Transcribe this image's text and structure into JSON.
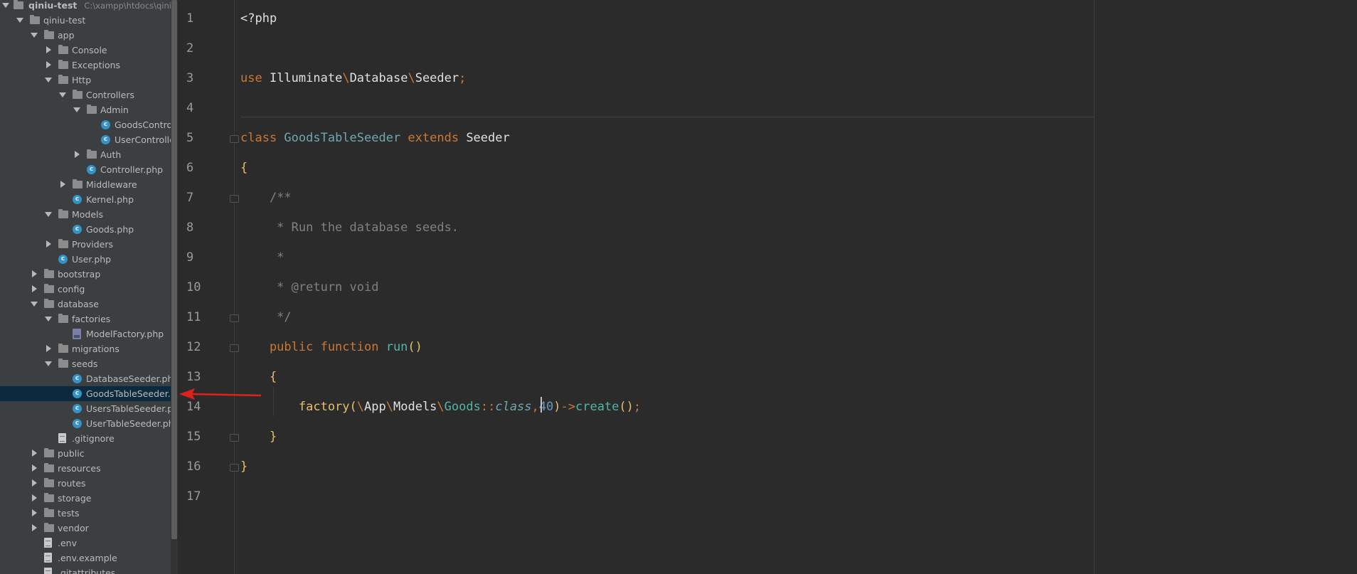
{
  "project": {
    "root_name": "qiniu-test",
    "root_path": "C:\\xampp\\htdocs\\qiniu-t"
  },
  "tree": [
    {
      "label": "qiniu-test",
      "kind": "folder",
      "depth": 1,
      "open": true
    },
    {
      "label": "app",
      "kind": "folder",
      "depth": 2,
      "open": true
    },
    {
      "label": "Console",
      "kind": "folder",
      "depth": 3,
      "open": false
    },
    {
      "label": "Exceptions",
      "kind": "folder",
      "depth": 3,
      "open": false
    },
    {
      "label": "Http",
      "kind": "folder",
      "depth": 3,
      "open": true
    },
    {
      "label": "Controllers",
      "kind": "folder",
      "depth": 4,
      "open": true
    },
    {
      "label": "Admin",
      "kind": "folder",
      "depth": 5,
      "open": true
    },
    {
      "label": "GoodsControlle",
      "kind": "class",
      "depth": 6
    },
    {
      "label": "UserController.",
      "kind": "class",
      "depth": 6
    },
    {
      "label": "Auth",
      "kind": "folder",
      "depth": 5,
      "open": false
    },
    {
      "label": "Controller.php",
      "kind": "class",
      "depth": 5
    },
    {
      "label": "Middleware",
      "kind": "folder",
      "depth": 4,
      "open": false
    },
    {
      "label": "Kernel.php",
      "kind": "class",
      "depth": 4
    },
    {
      "label": "Models",
      "kind": "folder",
      "depth": 3,
      "open": true
    },
    {
      "label": "Goods.php",
      "kind": "class",
      "depth": 4
    },
    {
      "label": "Providers",
      "kind": "folder",
      "depth": 3,
      "open": false
    },
    {
      "label": "User.php",
      "kind": "class",
      "depth": 3
    },
    {
      "label": "bootstrap",
      "kind": "folder",
      "depth": 2,
      "open": false
    },
    {
      "label": "config",
      "kind": "folder",
      "depth": 2,
      "open": false
    },
    {
      "label": "database",
      "kind": "folder",
      "depth": 2,
      "open": true
    },
    {
      "label": "factories",
      "kind": "folder",
      "depth": 3,
      "open": true
    },
    {
      "label": "ModelFactory.php",
      "kind": "php",
      "depth": 4
    },
    {
      "label": "migrations",
      "kind": "folder",
      "depth": 3,
      "open": false
    },
    {
      "label": "seeds",
      "kind": "folder",
      "depth": 3,
      "open": true
    },
    {
      "label": "DatabaseSeeder.php",
      "kind": "class",
      "depth": 4
    },
    {
      "label": "GoodsTableSeeder.ph",
      "kind": "class",
      "depth": 4,
      "selected": true
    },
    {
      "label": "UsersTableSeeder.php",
      "kind": "class",
      "depth": 4
    },
    {
      "label": "UserTableSeeder.php",
      "kind": "class",
      "depth": 4
    },
    {
      "label": ".gitignore",
      "kind": "file",
      "depth": 3
    },
    {
      "label": "public",
      "kind": "folder",
      "depth": 2,
      "open": false
    },
    {
      "label": "resources",
      "kind": "folder",
      "depth": 2,
      "open": false
    },
    {
      "label": "routes",
      "kind": "folder",
      "depth": 2,
      "open": false
    },
    {
      "label": "storage",
      "kind": "folder",
      "depth": 2,
      "open": false
    },
    {
      "label": "tests",
      "kind": "folder",
      "depth": 2,
      "open": false
    },
    {
      "label": "vendor",
      "kind": "folder",
      "depth": 2,
      "open": false
    },
    {
      "label": ".env",
      "kind": "file",
      "depth": 2
    },
    {
      "label": ".env.example",
      "kind": "file",
      "depth": 2
    },
    {
      "label": ".gitattributes",
      "kind": "file",
      "depth": 2
    }
  ],
  "editor": {
    "line_numbers": [
      "1",
      "2",
      "3",
      "4",
      "5",
      "6",
      "7",
      "8",
      "9",
      "10",
      "11",
      "12",
      "13",
      "14",
      "15",
      "16",
      "17"
    ],
    "lines": [
      [
        {
          "t": "<?php",
          "c": "plain"
        }
      ],
      [],
      [
        {
          "t": "use ",
          "c": "kw"
        },
        {
          "t": "Illuminate",
          "c": "plain"
        },
        {
          "t": "\\",
          "c": "kw"
        },
        {
          "t": "Database",
          "c": "plain"
        },
        {
          "t": "\\",
          "c": "kw"
        },
        {
          "t": "Seeder",
          "c": "plain"
        },
        {
          "t": ";",
          "c": "kw"
        }
      ],
      [],
      [
        {
          "t": "class ",
          "c": "kw"
        },
        {
          "t": "GoodsTableSeeder ",
          "c": "cls-name"
        },
        {
          "t": "extends ",
          "c": "kw"
        },
        {
          "t": "Seeder",
          "c": "plain"
        }
      ],
      [
        {
          "t": "{",
          "c": "brace"
        }
      ],
      [
        {
          "t": "    /**",
          "c": "cmt"
        }
      ],
      [
        {
          "t": "     * Run the database seeds.",
          "c": "cmt"
        }
      ],
      [
        {
          "t": "     *",
          "c": "cmt"
        }
      ],
      [
        {
          "t": "     * @return ",
          "c": "cmt"
        },
        {
          "t": "void",
          "c": "cmt"
        }
      ],
      [
        {
          "t": "     */",
          "c": "cmt"
        }
      ],
      [
        {
          "t": "    public function ",
          "c": "kw"
        },
        {
          "t": "run",
          "c": "fn"
        },
        {
          "t": "()",
          "c": "brace"
        }
      ],
      [
        {
          "t": "    {",
          "c": "brace"
        }
      ],
      [
        {
          "t": "        factory",
          "c": "brace"
        },
        {
          "t": "(",
          "c": "brace"
        },
        {
          "t": "\\",
          "c": "kw"
        },
        {
          "t": "App",
          "c": "plain"
        },
        {
          "t": "\\",
          "c": "kw"
        },
        {
          "t": "Models",
          "c": "plain"
        },
        {
          "t": "\\",
          "c": "kw"
        },
        {
          "t": "Goods",
          "c": "fn"
        },
        {
          "t": "::",
          "c": "kw"
        },
        {
          "t": "class",
          "c": "ital"
        },
        {
          "t": ",",
          "c": "kw"
        },
        {
          "t": "40",
          "c": "num"
        },
        {
          "t": ")",
          "c": "brace"
        },
        {
          "t": "->",
          "c": "kw"
        },
        {
          "t": "create",
          "c": "fn"
        },
        {
          "t": "()",
          "c": "brace"
        },
        {
          "t": ";",
          "c": "kw"
        }
      ],
      [
        {
          "t": "    }",
          "c": "brace"
        }
      ],
      [
        {
          "t": "}",
          "c": "brace"
        }
      ],
      []
    ]
  },
  "colors": {
    "tree_bg": "#3c3f41",
    "selection": "#0d293e",
    "editor_bg": "#2b2b2b",
    "annotation_arrow": "#e0201c"
  }
}
